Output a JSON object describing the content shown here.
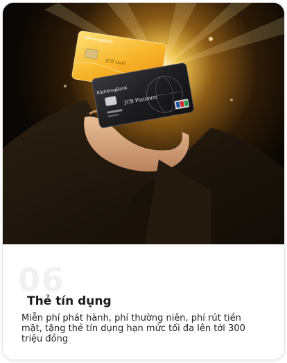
{
  "feature": {
    "number": "06",
    "title": "Thẻ tín dụng",
    "description": "Miễn phí phát hành, phí thường niên, phí rút tiền mặt, tặng thẻ tín dụng hạn mức tối đa lên tới 300 triệu đồng"
  },
  "cards": {
    "gold": {
      "bank": "KienlongBank",
      "product": "JCB Gold"
    },
    "platinum": {
      "bank": "KienlongBank",
      "product": "JCB Platinum"
    }
  },
  "colors": {
    "hero_background": "#0c0805",
    "gold_card": "#f3b62a",
    "platinum_card": "#232326",
    "title_text": "#1b1b1b",
    "number_watermark": "#f1f1f1"
  }
}
